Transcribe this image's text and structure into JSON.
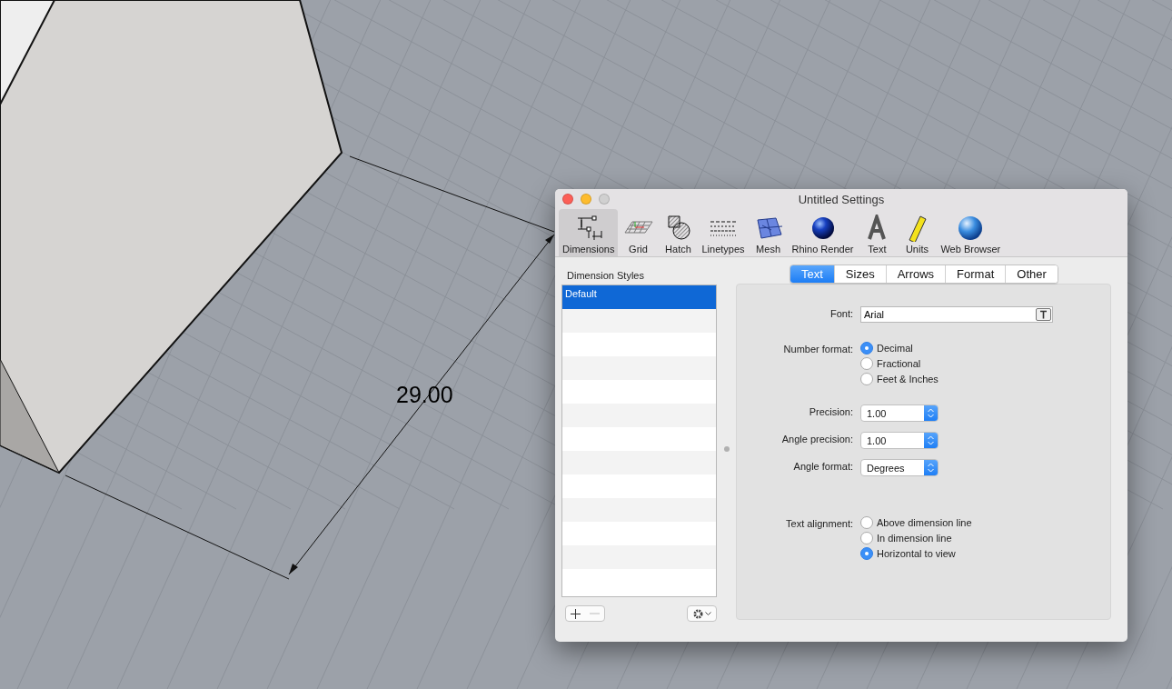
{
  "viewport": {
    "dimension_label": "29.00"
  },
  "window": {
    "title": "Untitled Settings"
  },
  "toolbar": [
    {
      "label": "Dimensions",
      "kind": "dimensions",
      "selected": true
    },
    {
      "label": "Grid",
      "kind": "grid",
      "selected": false
    },
    {
      "label": "Hatch",
      "kind": "hatch",
      "selected": false
    },
    {
      "label": "Linetypes",
      "kind": "linetypes",
      "selected": false
    },
    {
      "label": "Mesh",
      "kind": "mesh",
      "selected": false
    },
    {
      "label": "Rhino Render",
      "kind": "sphere",
      "selected": false
    },
    {
      "label": "Text",
      "kind": "text",
      "selected": false
    },
    {
      "label": "Units",
      "kind": "ruler",
      "selected": false
    },
    {
      "label": "Web Browser",
      "kind": "globe",
      "selected": false
    }
  ],
  "styles_panel": {
    "title": "Dimension Styles",
    "items": [
      {
        "label": "Default",
        "selected": true
      }
    ]
  },
  "tabs": [
    {
      "label": "Text",
      "selected": true
    },
    {
      "label": "Sizes",
      "selected": false
    },
    {
      "label": "Arrows",
      "selected": false
    },
    {
      "label": "Format",
      "selected": false
    },
    {
      "label": "Other",
      "selected": false
    }
  ],
  "form": {
    "font": {
      "label": "Font:",
      "value": "Arial"
    },
    "number_format": {
      "label": "Number format:",
      "options": [
        {
          "label": "Decimal",
          "selected": true
        },
        {
          "label": "Fractional",
          "selected": false
        },
        {
          "label": "Feet & Inches",
          "selected": false
        }
      ]
    },
    "selects": [
      {
        "label": "Precision:",
        "value": "1.00"
      },
      {
        "label": "Angle precision:",
        "value": "1.00"
      },
      {
        "label": "Angle format:",
        "value": "Degrees"
      }
    ],
    "text_alignment": {
      "label": "Text alignment:",
      "options": [
        {
          "label": "Above dimension line",
          "selected": false
        },
        {
          "label": "In dimension line",
          "selected": false
        },
        {
          "label": "Horizontal to view",
          "selected": true
        }
      ]
    }
  }
}
